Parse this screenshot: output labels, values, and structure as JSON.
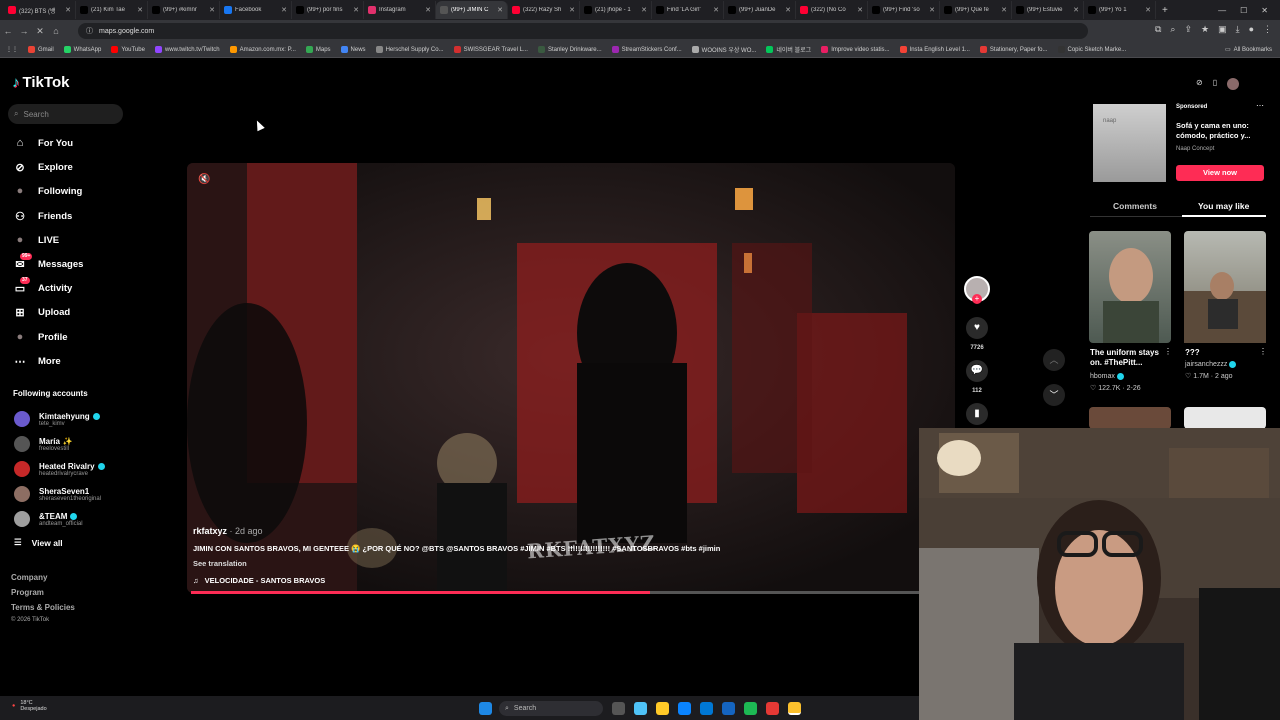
{
  "browser": {
    "tabs": [
      {
        "title": "(322) BTS (뱅",
        "icon_color": "#ff0033",
        "icon": "youtube-icon"
      },
      {
        "title": "(21) Kim Tae",
        "icon_color": "#000000",
        "icon": "x-icon"
      },
      {
        "title": "(99+) #kimnr",
        "icon_color": "#000000",
        "icon": "tiktok-icon"
      },
      {
        "title": "Facebook",
        "icon_color": "#1877f2",
        "icon": "facebook-icon"
      },
      {
        "title": "(99+) por fins",
        "icon_color": "#000000",
        "icon": "tiktok-icon"
      },
      {
        "title": "Instagram",
        "icon_color": "#e1306c",
        "icon": "instagram-icon"
      },
      {
        "title": "(99+) JIMIN C",
        "icon_color": "#555555",
        "icon": "loading-icon",
        "active": true
      },
      {
        "title": "(322) Raży Sh",
        "icon_color": "#ff0033",
        "icon": "youtube-icon"
      },
      {
        "title": "(21) jhope - 1",
        "icon_color": "#000000",
        "icon": "x-icon"
      },
      {
        "title": "Find 'LA Girl'",
        "icon_color": "#000000",
        "icon": "tiktok-icon"
      },
      {
        "title": "(99+) JuanDe",
        "icon_color": "#000000",
        "icon": "tiktok-icon"
      },
      {
        "title": "(322) (No Co",
        "icon_color": "#ff0033",
        "icon": "youtube-icon"
      },
      {
        "title": "(99+) Find 'so",
        "icon_color": "#000000",
        "icon": "tiktok-icon"
      },
      {
        "title": "(99+) Que fe",
        "icon_color": "#000000",
        "icon": "tiktok-icon"
      },
      {
        "title": "(99+) Estuvie",
        "icon_color": "#000000",
        "icon": "tiktok-icon"
      },
      {
        "title": "(99+) Yo 1",
        "icon_color": "#000000",
        "icon": "tiktok-icon"
      }
    ],
    "new_tab": "+",
    "url": "maps.google.com",
    "bookmarks": [
      {
        "label": "Gmail",
        "color": "#ea4335"
      },
      {
        "label": "WhatsApp",
        "color": "#25d366"
      },
      {
        "label": "YouTube",
        "color": "#ff0000"
      },
      {
        "label": "www.twitch.tv/Twitch",
        "color": "#9146ff"
      },
      {
        "label": "Amazon.com.mx: P...",
        "color": "#ff9900"
      },
      {
        "label": "Maps",
        "color": "#34a853"
      },
      {
        "label": "News",
        "color": "#4285f4"
      },
      {
        "label": "Herschel Supply Co...",
        "color": "#888888"
      },
      {
        "label": "SWISSGEAR Travel L...",
        "color": "#d32f2f"
      },
      {
        "label": "Stanley Drinkware...",
        "color": "#3a5a40"
      },
      {
        "label": "StreamStickers Conf...",
        "color": "#9c27b0"
      },
      {
        "label": "WOOINS 우상 WO...",
        "color": "#aaaaaa"
      },
      {
        "label": "네이버 블로그",
        "color": "#03c75a"
      },
      {
        "label": "Improve video statis...",
        "color": "#e91e63"
      },
      {
        "label": "Insta English Level 1...",
        "color": "#f44336"
      },
      {
        "label": "Stationery, Paper fo...",
        "color": "#e53935"
      },
      {
        "label": "Copic Sketch Marke...",
        "color": "#333333"
      }
    ],
    "all_bookmarks": "All Bookmarks"
  },
  "sidebar": {
    "logo": "TikTok",
    "search_placeholder": "Search",
    "nav": [
      {
        "label": "For You",
        "icon": "home-icon",
        "glyph": "⌂"
      },
      {
        "label": "Explore",
        "icon": "compass-icon",
        "glyph": "⊘"
      },
      {
        "label": "Following",
        "icon": "following-avatar-icon",
        "glyph": "●"
      },
      {
        "label": "Friends",
        "icon": "friends-icon",
        "glyph": "⚇"
      },
      {
        "label": "LIVE",
        "icon": "live-avatar-icon",
        "glyph": "●"
      },
      {
        "label": "Messages",
        "icon": "message-icon",
        "glyph": "✉",
        "badge": "99+"
      },
      {
        "label": "Activity",
        "icon": "activity-icon",
        "glyph": "▭",
        "badge": "37"
      },
      {
        "label": "Upload",
        "icon": "upload-icon",
        "glyph": "⊞"
      },
      {
        "label": "Profile",
        "icon": "profile-avatar-icon",
        "glyph": "●"
      },
      {
        "label": "More",
        "icon": "more-icon",
        "glyph": "⋯"
      }
    ],
    "following_title": "Following accounts",
    "accounts": [
      {
        "name": "Kimtaehyung",
        "handle": "tete_kimv",
        "verified": true,
        "color": "#6a5acd"
      },
      {
        "name": "María",
        "handle": "freelovestill",
        "verified": false,
        "sparkle": "✨",
        "color": "#555555"
      },
      {
        "name": "Heated Rivalry",
        "handle": "heatedrivalrycrave",
        "verified": true,
        "color": "#c62828"
      },
      {
        "name": "SheraSeven1",
        "handle": "sheraseven1theoriginal",
        "verified": false,
        "color": "#8d6e63"
      },
      {
        "name": "&TEAM",
        "handle": "andteam_official",
        "verified": true,
        "color": "#9e9e9e"
      }
    ],
    "view_all": "View all",
    "footer": [
      "Company",
      "Program",
      "Terms & Policies",
      "© 2026 TikTok"
    ]
  },
  "video": {
    "author": "rkfatxyz",
    "time": " · 2d ago",
    "caption": "JIMIN CON SANTOS BRAVOS, MI GENTEEE 😭 ¿POR QUÉ NO? @BTS @SANTOS BRAVOS #JIMIN #BTS !!!!!!!!!!!!!!!!! #SANTOSBRAVOS #bts #jimin",
    "see_translation": "See translation",
    "music": "VELOCIDADE - SANTOS BRAVOS",
    "watermark": "RKFATXYZ",
    "progress": 0.63
  },
  "actions": {
    "likes": "7726",
    "comments": "112"
  },
  "right_panel": {
    "ad": {
      "sponsored": "Sponsored",
      "title": "Sofá y cama en uno: cómodo, práctico y...",
      "brand": "Naap Concept",
      "cta": "View now",
      "thumb_text": "naap"
    },
    "tabs": [
      "Comments",
      "You may like"
    ],
    "cards": [
      {
        "title": "The uniform stays on. #ThePitt...",
        "user": "hbomax",
        "verified": true,
        "likes": "122.7K",
        "date": "2-26"
      },
      {
        "title": "???",
        "user": "jairsanchezzz",
        "verified": true,
        "likes": "1.7M",
        "date": "2 ago"
      }
    ]
  },
  "taskbar": {
    "temp": "18°C",
    "weather": "Despejado",
    "search": "Search"
  }
}
